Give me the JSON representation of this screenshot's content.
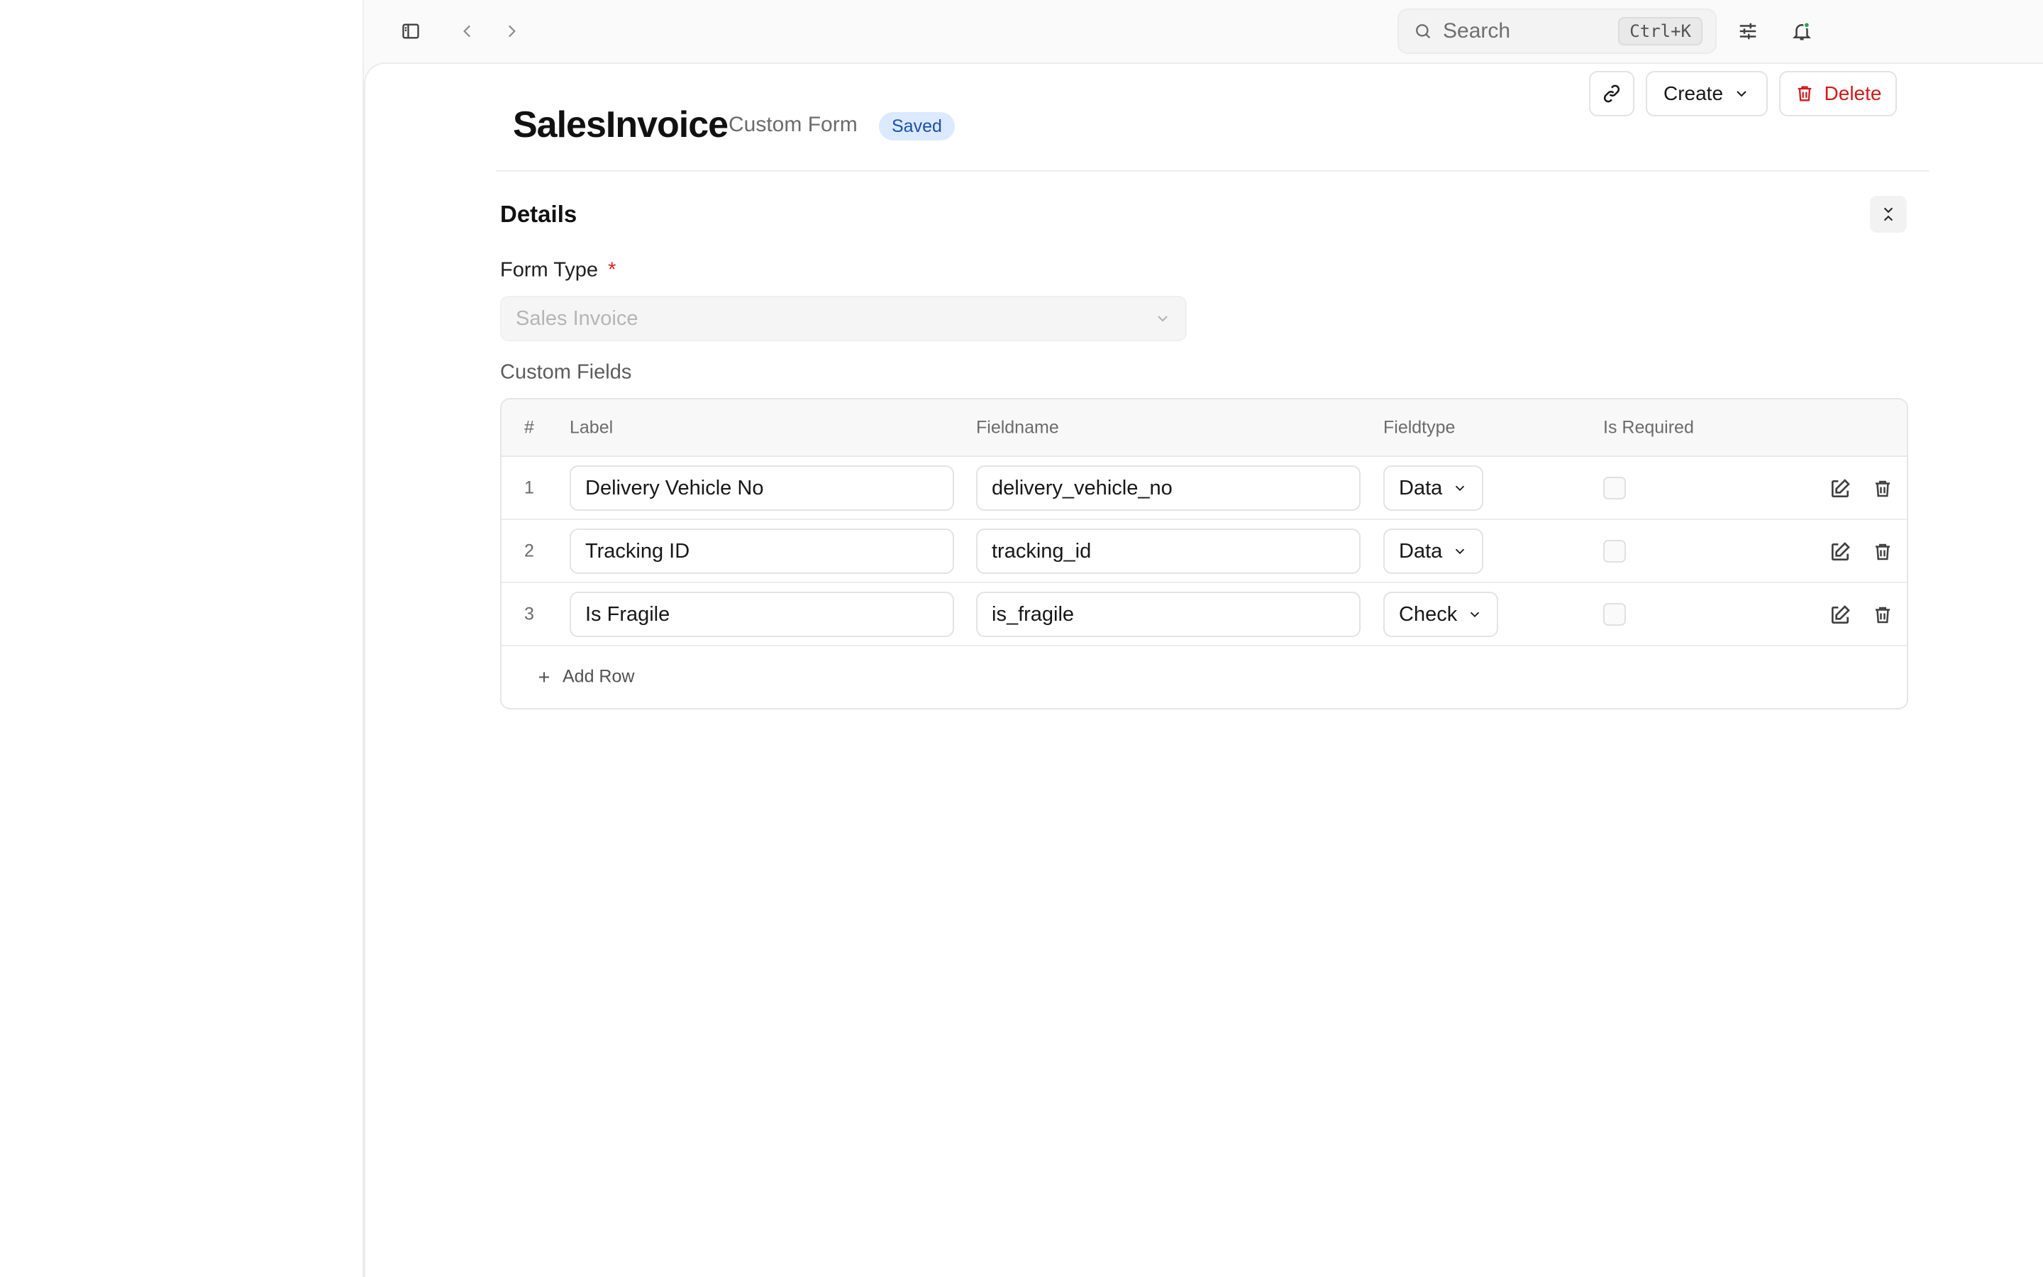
{
  "topbar": {
    "search_placeholder": "Search",
    "search_shortcut": "Ctrl+K"
  },
  "header": {
    "title": "SalesInvoice",
    "subtitle": "Custom Form",
    "status_badge": "Saved",
    "create_label": "Create",
    "delete_label": "Delete"
  },
  "section": {
    "title": "Details"
  },
  "form_type": {
    "label": "Form Type",
    "required_mark": "*",
    "value": "Sales Invoice"
  },
  "custom_fields": {
    "label": "Custom Fields",
    "columns": [
      "#",
      "Label",
      "Fieldname",
      "Fieldtype",
      "Is Required"
    ],
    "rows": [
      {
        "index": "1",
        "label": "Delivery Vehicle No",
        "fieldname": "delivery_vehicle_no",
        "fieldtype": "Data",
        "is_required": false
      },
      {
        "index": "2",
        "label": "Tracking ID",
        "fieldname": "tracking_id",
        "fieldtype": "Data",
        "is_required": false
      },
      {
        "index": "3",
        "label": "Is Fragile",
        "fieldname": "is_fragile",
        "fieldtype": "Check",
        "is_required": false
      }
    ],
    "add_row_label": "Add Row"
  },
  "colors": {
    "badge_bg": "#dbeafe",
    "badge_text": "#1e4fb0",
    "danger": "#d11a1a",
    "notification_dot": "#22a35a"
  },
  "icons": {
    "sidebar_toggle": "sidebar-toggle-icon",
    "back": "chevron-left-icon",
    "forward": "chevron-right-icon",
    "search": "search-icon",
    "filters": "sliders-icon",
    "notifications": "bell-icon",
    "link": "link-icon",
    "dropdown": "chevron-down-icon",
    "trash": "trash-icon",
    "collapse": "collapse-icon",
    "edit": "edit-icon",
    "add": "plus-icon"
  }
}
